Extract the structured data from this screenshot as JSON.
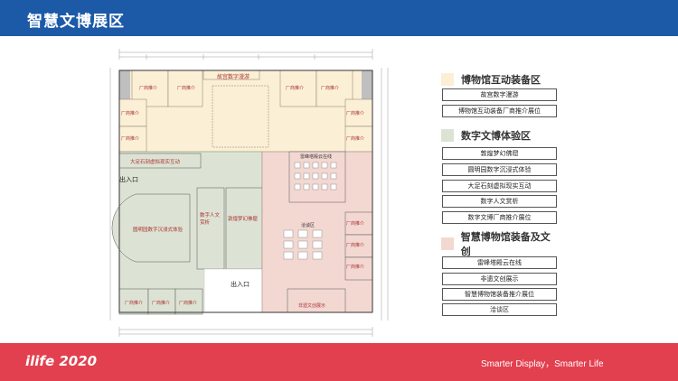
{
  "header": {
    "title": "智慧文博展区"
  },
  "footer": {
    "brand": "ilife 2020",
    "slogan": "Smarter Display，Smarter Life"
  },
  "colors": {
    "blue": "#1c5aa8",
    "red": "#e2404f",
    "cream": "#fbf0d6",
    "green": "#dde3d4",
    "pink": "#f3d8d2"
  },
  "legend": {
    "zones": [
      {
        "title": "博物馆互动装备区",
        "color": "#fbf0d6",
        "items": [
          "故宫数字漫游",
          "博物馆互动装备厂商推介展位"
        ]
      },
      {
        "title": "数字文博体验区",
        "color": "#dde3d4",
        "items": [
          "敦煌梦幻佛窟",
          "圆明园数字沉浸式体验",
          "大足石刻虚拟现实互动",
          "数字人文赏析",
          "数字文博厂商推介展位"
        ]
      },
      {
        "title": "智慧博物馆装备及文创",
        "color": "#f3d8d2",
        "items": [
          "雷峰塔殿云在线",
          "非遗文创展示",
          "智慧博物馆装备推介展位",
          "洽谈区"
        ]
      }
    ]
  },
  "plan": {
    "entrances": [
      "出入口",
      "出入口"
    ],
    "booths": {
      "top_center": "故宫数字漫游",
      "dazu": "大足石刻虚拟现实互动",
      "yuanmingyuan": "圆明园数字沉浸式体验",
      "renwen": "数字人文赏析",
      "dunhuang": "敦煌梦幻佛窟",
      "leifeng": "雷峰塔殿云在线",
      "negotiation": "洽谈区",
      "feiyi": "非遗文创展示"
    },
    "vendor_label": "厂商推介"
  }
}
